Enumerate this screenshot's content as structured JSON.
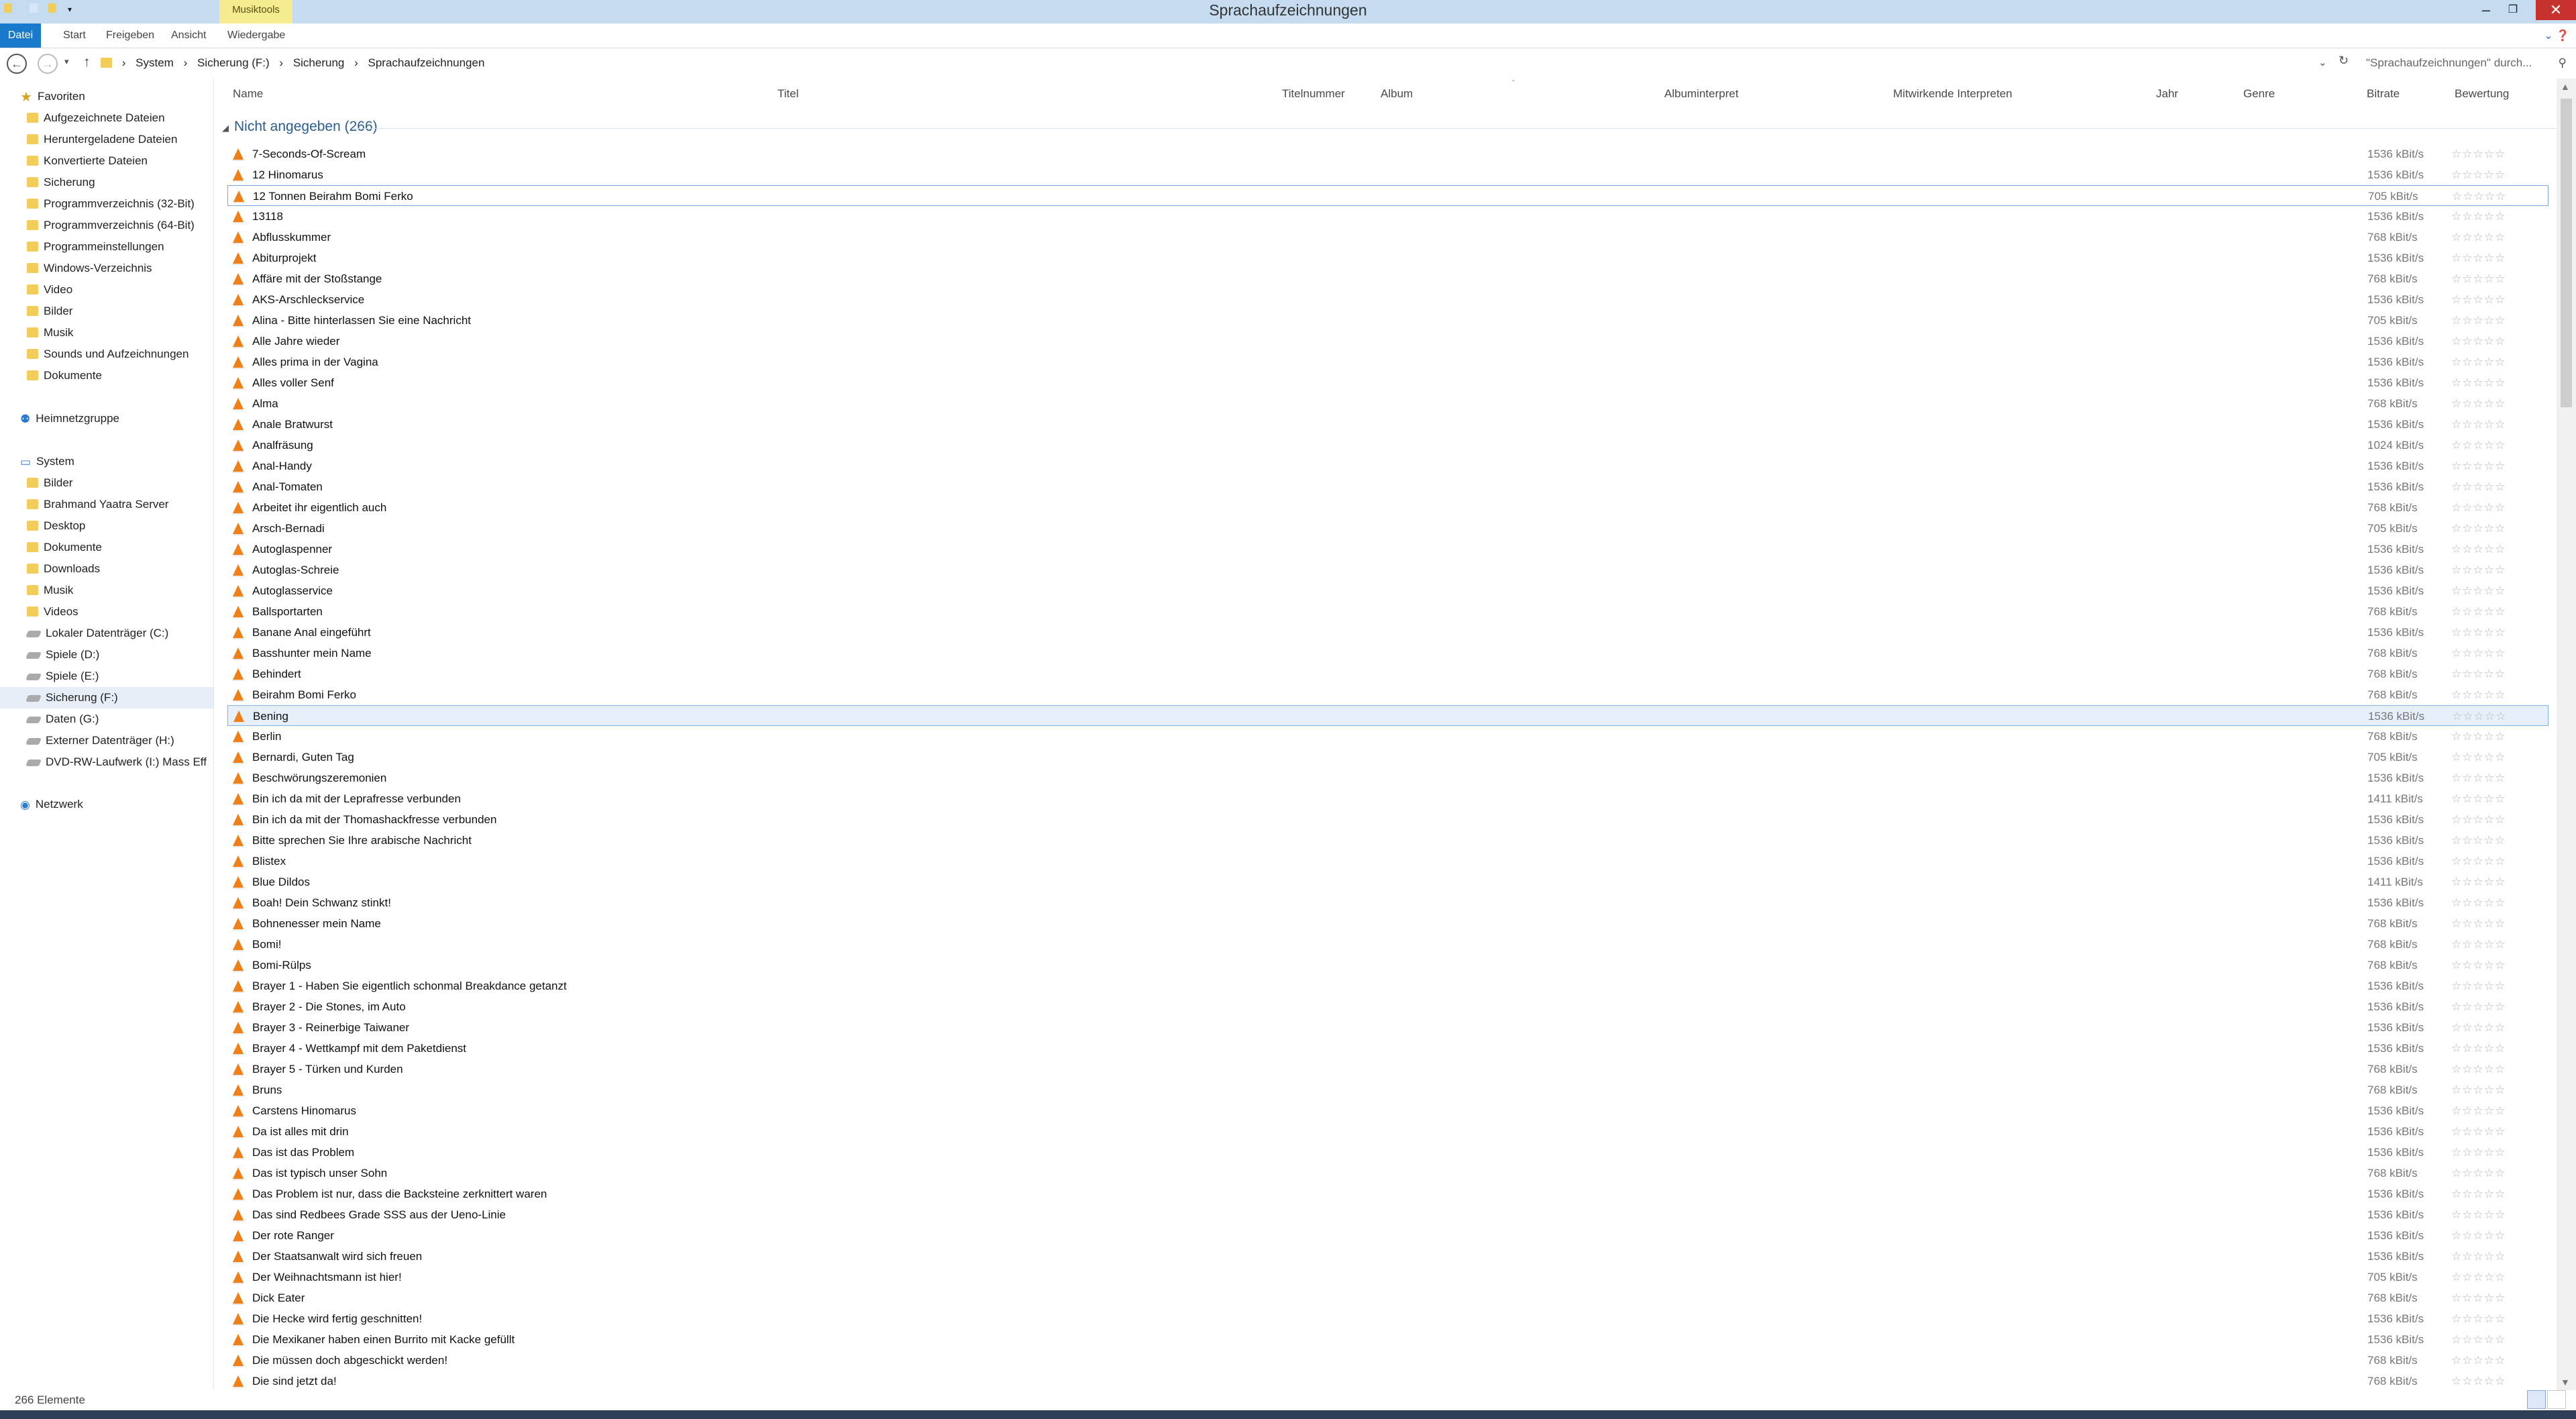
{
  "window": {
    "title": "Sprachaufzeichnungen",
    "context_tab": "Musiktools"
  },
  "ribbon": {
    "tabs": [
      "Datei",
      "Start",
      "Freigeben",
      "Ansicht",
      "Wiedergabe"
    ]
  },
  "address": {
    "breadcrumbs": [
      "System",
      "Sicherung (F:)",
      "Sicherung",
      "Sprachaufzeichnungen"
    ],
    "search_placeholder": "\"Sprachaufzeichnungen\" durch..."
  },
  "nav": {
    "favorites_label": "Favoriten",
    "favorites": [
      "Aufgezeichnete Dateien",
      "Heruntergeladene Dateien",
      "Konvertierte Dateien",
      "Sicherung",
      "Programmverzeichnis (32-Bit)",
      "Programmverzeichnis (64-Bit)",
      "Programmeinstellungen",
      "Windows-Verzeichnis",
      "Video",
      "Bilder",
      "Musik",
      "Sounds und Aufzeichnungen",
      "Dokumente"
    ],
    "homegroup_label": "Heimnetzgruppe",
    "system_label": "System",
    "system": [
      "Bilder",
      "Brahmand Yaatra Server",
      "Desktop",
      "Dokumente",
      "Downloads",
      "Musik",
      "Videos",
      "Lokaler Datenträger (C:)",
      "Spiele (D:)",
      "Spiele (E:)",
      "Sicherung (F:)",
      "Daten (G:)",
      "Externer Datenträger (H:)",
      "DVD-RW-Laufwerk (I:) Mass Eff"
    ],
    "network_label": "Netzwerk"
  },
  "columns": [
    "Name",
    "Titel",
    "Titelnummer",
    "Album",
    "Albuminterpret",
    "Mitwirkende Interpreten",
    "Jahr",
    "Genre",
    "Bitrate",
    "Bewertung"
  ],
  "group_header": "Nicht angegeben (266)",
  "rating_stars": "☆☆☆☆☆",
  "rows": [
    {
      "name": "7-Seconds-Of-Scream",
      "bitrate": "1536 kBit/s"
    },
    {
      "name": "12 Hinomarus",
      "bitrate": "1536 kBit/s"
    },
    {
      "name": "12 Tonnen Beirahm Bomi Ferko",
      "bitrate": "705 kBit/s"
    },
    {
      "name": "13118",
      "bitrate": "1536 kBit/s"
    },
    {
      "name": "Abflusskummer",
      "bitrate": "768 kBit/s"
    },
    {
      "name": "Abiturprojekt",
      "bitrate": "1536 kBit/s"
    },
    {
      "name": "Affäre mit der Stoßstange",
      "bitrate": "768 kBit/s"
    },
    {
      "name": "AKS-Arschleckservice",
      "bitrate": "1536 kBit/s"
    },
    {
      "name": "Alina - Bitte hinterlassen Sie eine Nachricht",
      "bitrate": "705 kBit/s"
    },
    {
      "name": "Alle Jahre wieder",
      "bitrate": "1536 kBit/s"
    },
    {
      "name": "Alles prima in der Vagina",
      "bitrate": "1536 kBit/s"
    },
    {
      "name": "Alles voller Senf",
      "bitrate": "1536 kBit/s"
    },
    {
      "name": "Alma",
      "bitrate": "768 kBit/s"
    },
    {
      "name": "Anale Bratwurst",
      "bitrate": "1536 kBit/s"
    },
    {
      "name": "Analfräsung",
      "bitrate": "1024 kBit/s"
    },
    {
      "name": "Anal-Handy",
      "bitrate": "1536 kBit/s"
    },
    {
      "name": "Anal-Tomaten",
      "bitrate": "1536 kBit/s"
    },
    {
      "name": "Arbeitet ihr eigentlich auch",
      "bitrate": "768 kBit/s"
    },
    {
      "name": "Arsch-Bernadi",
      "bitrate": "705 kBit/s"
    },
    {
      "name": "Autoglaspenner",
      "bitrate": "1536 kBit/s"
    },
    {
      "name": "Autoglas-Schreie",
      "bitrate": "1536 kBit/s"
    },
    {
      "name": "Autoglasservice",
      "bitrate": "1536 kBit/s"
    },
    {
      "name": "Ballsportarten",
      "bitrate": "768 kBit/s"
    },
    {
      "name": "Banane Anal eingeführt",
      "bitrate": "1536 kBit/s"
    },
    {
      "name": "Basshunter mein Name",
      "bitrate": "768 kBit/s"
    },
    {
      "name": "Behindert",
      "bitrate": "768 kBit/s"
    },
    {
      "name": "Beirahm Bomi Ferko",
      "bitrate": "768 kBit/s"
    },
    {
      "name": "Bening",
      "bitrate": "1536 kBit/s"
    },
    {
      "name": "Berlin",
      "bitrate": "768 kBit/s"
    },
    {
      "name": "Bernardi, Guten Tag",
      "bitrate": "705 kBit/s"
    },
    {
      "name": "Beschwörungszeremonien",
      "bitrate": "1536 kBit/s"
    },
    {
      "name": "Bin ich da mit der Leprafresse verbunden",
      "bitrate": "1411 kBit/s"
    },
    {
      "name": "Bin ich da mit der Thomashackfresse verbunden",
      "bitrate": "1536 kBit/s"
    },
    {
      "name": "Bitte sprechen Sie Ihre arabische Nachricht",
      "bitrate": "1536 kBit/s"
    },
    {
      "name": "Blistex",
      "bitrate": "1536 kBit/s"
    },
    {
      "name": "Blue Dildos",
      "bitrate": "1411 kBit/s"
    },
    {
      "name": "Boah! Dein Schwanz stinkt!",
      "bitrate": "1536 kBit/s"
    },
    {
      "name": "Bohnenesser mein Name",
      "bitrate": "768 kBit/s"
    },
    {
      "name": "Bomi!",
      "bitrate": "768 kBit/s"
    },
    {
      "name": "Bomi-Rülps",
      "bitrate": "768 kBit/s"
    },
    {
      "name": "Brayer 1 - Haben Sie eigentlich schonmal Breakdance getanzt",
      "bitrate": "1536 kBit/s"
    },
    {
      "name": "Brayer 2 - Die Stones, im Auto",
      "bitrate": "1536 kBit/s"
    },
    {
      "name": "Brayer 3 - Reinerbige Taiwaner",
      "bitrate": "1536 kBit/s"
    },
    {
      "name": "Brayer 4 - Wettkampf mit dem Paketdienst",
      "bitrate": "1536 kBit/s"
    },
    {
      "name": "Brayer 5 - Türken und Kurden",
      "bitrate": "768 kBit/s"
    },
    {
      "name": "Bruns",
      "bitrate": "768 kBit/s"
    },
    {
      "name": "Carstens Hinomarus",
      "bitrate": "1536 kBit/s"
    },
    {
      "name": "Da ist alles mit drin",
      "bitrate": "1536 kBit/s"
    },
    {
      "name": "Das ist das Problem",
      "bitrate": "1536 kBit/s"
    },
    {
      "name": "Das ist typisch unser Sohn",
      "bitrate": "768 kBit/s"
    },
    {
      "name": "Das Problem ist nur, dass die Backsteine zerknittert waren",
      "bitrate": "1536 kBit/s"
    },
    {
      "name": "Das sind Redbees Grade SSS aus der Ueno-Linie",
      "bitrate": "1536 kBit/s"
    },
    {
      "name": "Der rote Ranger",
      "bitrate": "1536 kBit/s"
    },
    {
      "name": "Der Staatsanwalt wird sich freuen",
      "bitrate": "1536 kBit/s"
    },
    {
      "name": "Der Weihnachtsmann ist hier!",
      "bitrate": "705 kBit/s"
    },
    {
      "name": "Dick Eater",
      "bitrate": "768 kBit/s"
    },
    {
      "name": "Die Hecke wird fertig geschnitten!",
      "bitrate": "1536 kBit/s"
    },
    {
      "name": "Die Mexikaner haben einen Burrito mit Kacke gefüllt",
      "bitrate": "1536 kBit/s"
    },
    {
      "name": "Die müssen doch abgeschickt werden!",
      "bitrate": "768 kBit/s"
    },
    {
      "name": "Die sind jetzt da!",
      "bitrate": "768 kBit/s"
    }
  ],
  "status": {
    "count": "266 Elemente"
  }
}
